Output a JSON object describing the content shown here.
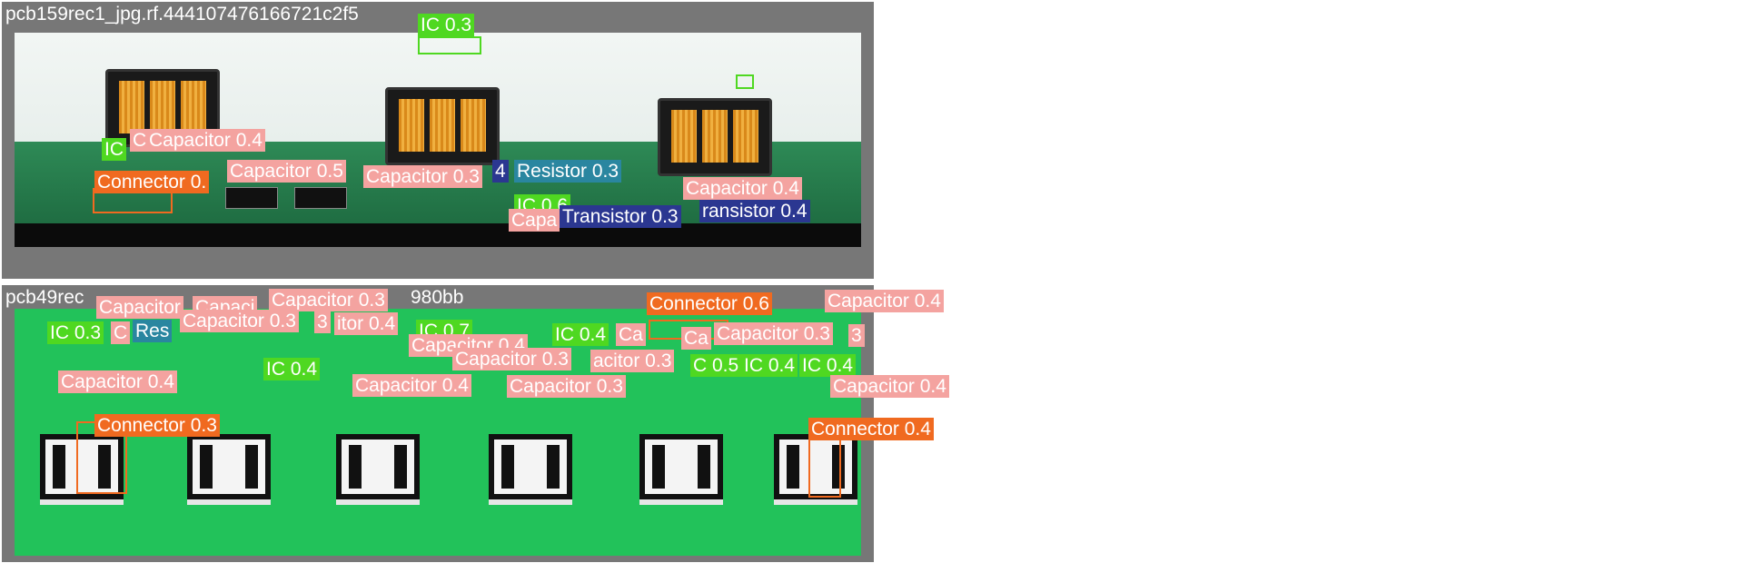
{
  "colors": {
    "capacitor": "#f4a3a0",
    "ic": "#4fd821",
    "resistor": "#2a86a0",
    "transistor": "#2b3791",
    "connector": "#f06a20",
    "panel_background": "#777777"
  },
  "panels": [
    {
      "title": "pcb159rec1_jpg.rf.4441074761667​21c2f5",
      "detections": [
        {
          "label": "IC 0.3",
          "class": "ic"
        },
        {
          "label": "IC",
          "class": "ic"
        },
        {
          "label": "C",
          "class": "capacitor"
        },
        {
          "label": "Capacitor 0.4",
          "class": "capacitor"
        },
        {
          "label": "Connector 0.",
          "class": "connector"
        },
        {
          "label": "Capacitor 0.5",
          "class": "capacitor"
        },
        {
          "label": "Capacitor 0.3",
          "class": "capacitor"
        },
        {
          "label": "4",
          "class": "transistor"
        },
        {
          "label": "Resistor 0.3",
          "class": "resistor"
        },
        {
          "label": "Capacitor 0.4",
          "class": "capacitor"
        },
        {
          "label": "IC 0.6",
          "class": "ic"
        },
        {
          "label": "Capa",
          "class": "capacitor"
        },
        {
          "label": "Transistor 0.3",
          "class": "transistor"
        },
        {
          "label": "ransistor 0.4",
          "class": "transistor"
        }
      ]
    },
    {
      "title": "pcb49rec",
      "title_tail": "980bb",
      "detections": [
        {
          "label": "Capacitor",
          "class": "capacitor"
        },
        {
          "label": "Capaci",
          "class": "capacitor"
        },
        {
          "label": "Capacitor 0.3",
          "class": "capacitor"
        },
        {
          "label": "Connector 0.6",
          "class": "connector"
        },
        {
          "label": "Capacitor 0.4",
          "class": "capacitor"
        },
        {
          "label": "IC 0.3",
          "class": "ic"
        },
        {
          "label": "C",
          "class": "capacitor"
        },
        {
          "label": "Res",
          "class": "resistor"
        },
        {
          "label": "Capacitor 0.3",
          "class": "capacitor"
        },
        {
          "label": "3",
          "class": "capacitor"
        },
        {
          "label": "itor 0.4",
          "class": "capacitor"
        },
        {
          "label": "IC 0.7",
          "class": "ic"
        },
        {
          "label": "IC 0.4",
          "class": "ic"
        },
        {
          "label": "Ca",
          "class": "capacitor"
        },
        {
          "label": "Ca",
          "class": "capacitor"
        },
        {
          "label": "Capacitor 0.3",
          "class": "capacitor"
        },
        {
          "label": "3",
          "class": "capacitor"
        },
        {
          "label": "Capacitor 0.4",
          "class": "capacitor"
        },
        {
          "label": "Capacitor 0.3",
          "class": "capacitor"
        },
        {
          "label": "acitor 0.3",
          "class": "capacitor"
        },
        {
          "label": "C 0.5",
          "class": "ic"
        },
        {
          "label": "IC 0.4",
          "class": "ic"
        },
        {
          "label": "IC 0.4",
          "class": "ic"
        },
        {
          "label": "IC 0.4",
          "class": "ic"
        },
        {
          "label": "Capacitor 0.4",
          "class": "capacitor"
        },
        {
          "label": "Capacitor 0.4",
          "class": "capacitor"
        },
        {
          "label": "Capacitor 0.3",
          "class": "capacitor"
        },
        {
          "label": "Capacitor 0.4",
          "class": "capacitor"
        },
        {
          "label": "Connector 0.3",
          "class": "connector"
        },
        {
          "label": "Connector 0.4",
          "class": "connector"
        }
      ]
    }
  ]
}
